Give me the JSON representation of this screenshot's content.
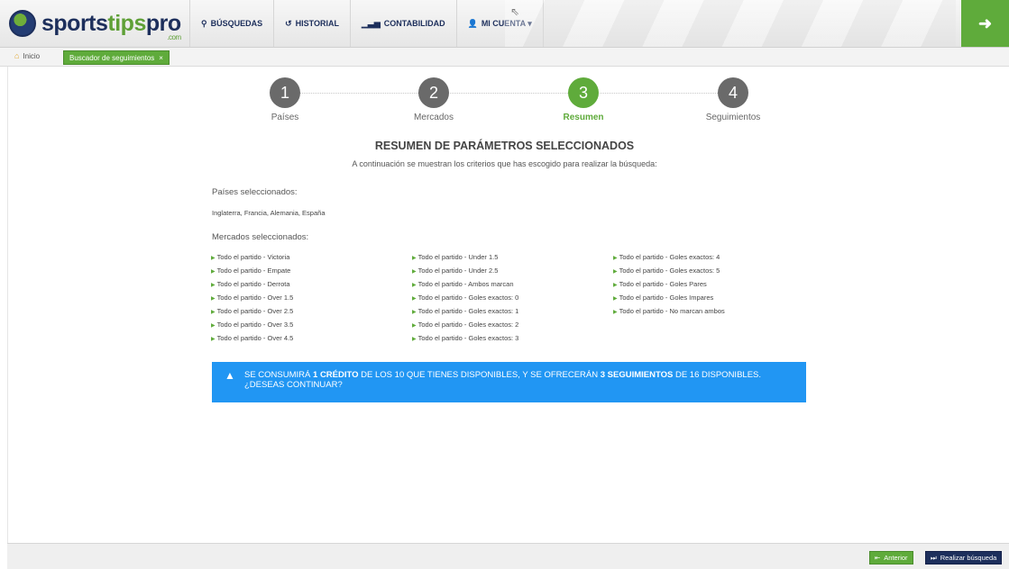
{
  "header": {
    "logo": {
      "part1": "sports",
      "part2": "tips",
      "part3": "pro",
      "sub": ".com"
    },
    "nav": [
      {
        "icon": "search-icon",
        "label": "BÚSQUEDAS"
      },
      {
        "icon": "history-icon",
        "label": "HISTORIAL"
      },
      {
        "icon": "chart-icon",
        "label": "CONTABILIDAD"
      },
      {
        "icon": "user-icon",
        "label": "MI CUENTA ▾"
      }
    ]
  },
  "breadcrumb": {
    "home": "Inicio",
    "tab": "Buscador de seguimientos"
  },
  "steps": [
    {
      "num": "1",
      "label": "Países"
    },
    {
      "num": "2",
      "label": "Mercados"
    },
    {
      "num": "3",
      "label": "Resumen"
    },
    {
      "num": "4",
      "label": "Seguimientos"
    }
  ],
  "summary": {
    "title": "RESUMEN DE PARÁMETROS SELECCIONADOS",
    "subtitle": "A continuación se muestran los criterios que has escogido para realizar la búsqueda:",
    "countries_label": "Países seleccionados:",
    "countries": "Inglaterra, Francia, Alemania, España",
    "markets_label": "Mercados seleccionados:",
    "markets": [
      "Todo el partido - Victoria",
      "Todo el partido - Empate",
      "Todo el partido - Derrota",
      "Todo el partido - Over 1.5",
      "Todo el partido - Over 2.5",
      "Todo el partido - Over 3.5",
      "Todo el partido - Over 4.5",
      "Todo el partido - Under 1.5",
      "Todo el partido - Under 2.5",
      "Todo el partido - Ambos marcan",
      "Todo el partido - Goles exactos: 0",
      "Todo el partido - Goles exactos: 1",
      "Todo el partido - Goles exactos: 2",
      "Todo el partido - Goles exactos: 3",
      "Todo el partido - Goles exactos: 4",
      "Todo el partido - Goles exactos: 5",
      "Todo el partido - Goles Pares",
      "Todo el partido - Goles Impares",
      "Todo el partido - No marcan ambos"
    ]
  },
  "alert": {
    "t1": "Se consumirá ",
    "b1": "1 crédito",
    "t2": " de los 10 que tienes disponibles, y se ofrecerán ",
    "b2": "3 seguimientos",
    "t3": " de 16 disponibles. ¿Deseas continuar?"
  },
  "footer": {
    "prev_label": "Anterior",
    "go_label": "Realizar búsqueda"
  },
  "colors": {
    "brand_green": "#5fab3b",
    "brand_navy": "#1d2f5c",
    "alert_blue": "#2196f3",
    "step_gray": "#6a6a6a"
  }
}
